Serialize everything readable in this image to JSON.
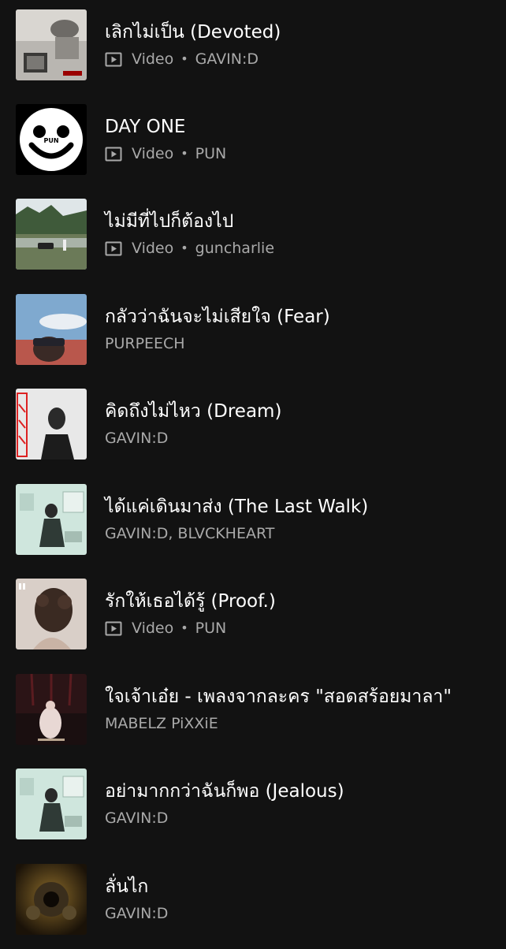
{
  "items": [
    {
      "title": "เลิกไม่เป็น (Devoted)",
      "is_video": true,
      "type_label": "Video",
      "separator": "•",
      "artist": "GAVIN:D",
      "thumb_icon": "devoted-album-art"
    },
    {
      "title": "DAY ONE",
      "is_video": true,
      "type_label": "Video",
      "separator": "•",
      "artist": "PUN",
      "thumb_icon": "smiley-face-album-art",
      "thumb_text": "PUN"
    },
    {
      "title": "ไม่มีที่ไปก็ต้องไป",
      "is_video": true,
      "type_label": "Video",
      "separator": "•",
      "artist": "guncharlie",
      "thumb_icon": "lake-landscape-album-art"
    },
    {
      "title": "กลัวว่าฉันจะไม่เสียใจ (Fear)",
      "is_video": false,
      "artist": "PURPEECH",
      "thumb_icon": "sky-portrait-album-art"
    },
    {
      "title": "คิดถึงไม่ไหว (Dream)",
      "is_video": false,
      "artist": "GAVIN:D",
      "thumb_icon": "dream-album-art"
    },
    {
      "title": "ได้แค่เดินมาส่ง (The Last Walk)",
      "is_video": false,
      "artist": "GAVIN:D, BLVCKHEART",
      "thumb_icon": "room-portrait-album-art"
    },
    {
      "title": "รักให้เธอได้รู้ (Proof.)",
      "is_video": true,
      "type_label": "Video",
      "separator": "•",
      "artist": "PUN",
      "thumb_icon": "curly-hair-album-art"
    },
    {
      "title": "ใจเจ้าเอ๋ย - เพลงจากละคร \"สอดสร้อยมาลา\"",
      "is_video": false,
      "artist": "MABELZ PiXXiE",
      "thumb_icon": "stage-dancer-album-art"
    },
    {
      "title": "อย่ามากกว่าฉันก็พอ (Jealous)",
      "is_video": false,
      "artist": "GAVIN:D",
      "thumb_icon": "room-portrait-album-art"
    },
    {
      "title": "ลั่นไก",
      "is_video": false,
      "artist": "GAVIN:D",
      "thumb_icon": "revolver-album-art"
    }
  ],
  "colors": {
    "background": "#121212",
    "title": "#ffffff",
    "subtitle": "#a9a9a9"
  }
}
